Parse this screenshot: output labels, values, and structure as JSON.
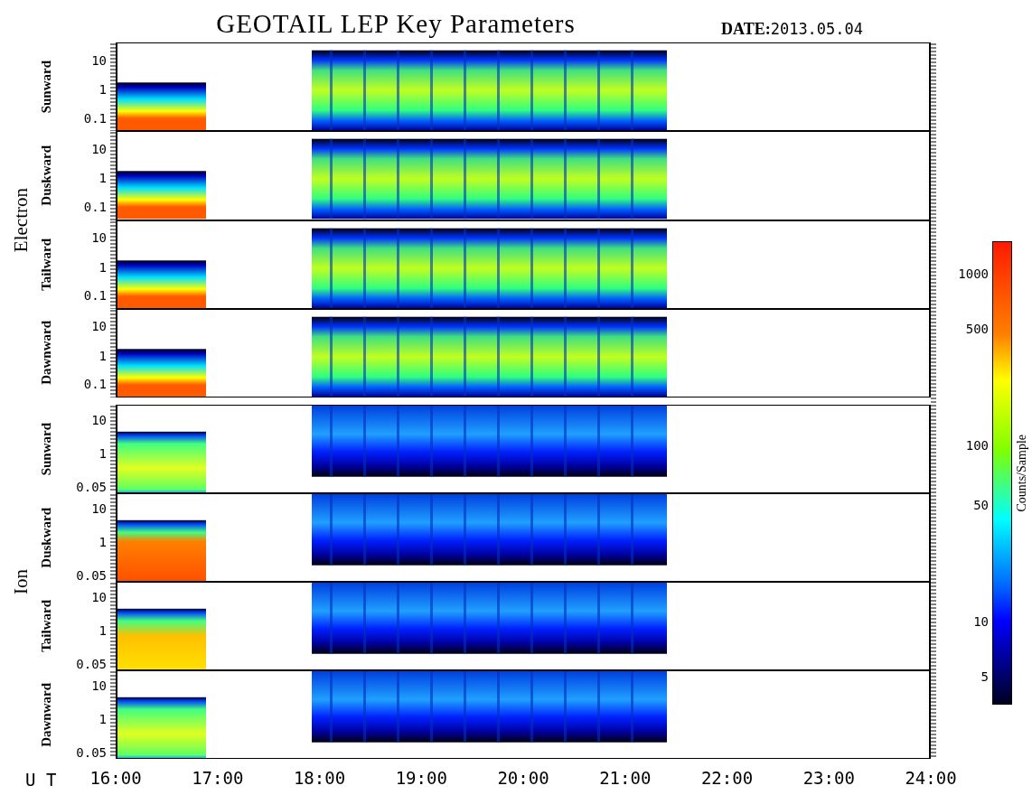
{
  "title": "GEOTAIL LEP Key Parameters",
  "date": {
    "label": "DATE:",
    "value": "2013.05.04"
  },
  "groups": [
    {
      "name": "Electron",
      "kind": "electron",
      "panels": [
        {
          "direction": "Sunward",
          "yticks": [
            "10",
            "1",
            "0.1"
          ]
        },
        {
          "direction": "Duskward",
          "yticks": [
            "10",
            "1",
            "0.1"
          ]
        },
        {
          "direction": "Tailward",
          "yticks": [
            "10",
            "1",
            "0.1"
          ]
        },
        {
          "direction": "Dawnward",
          "yticks": [
            "10",
            "1",
            "0.1"
          ]
        }
      ]
    },
    {
      "name": "Ion",
      "kind": "ion",
      "panels": [
        {
          "direction": "Sunward",
          "yticks": [
            "10",
            "1",
            "0.05"
          ]
        },
        {
          "direction": "Duskward",
          "yticks": [
            "10",
            "1",
            "0.05"
          ]
        },
        {
          "direction": "Tailward",
          "yticks": [
            "10",
            "1",
            "0.05"
          ]
        },
        {
          "direction": "Dawnward",
          "yticks": [
            "10",
            "1",
            "0.05"
          ]
        }
      ]
    }
  ],
  "time_axis": {
    "label": "U T",
    "ticks": [
      "16:00",
      "17:00",
      "18:00",
      "19:00",
      "20:00",
      "21:00",
      "22:00",
      "23:00",
      "24:00"
    ]
  },
  "colorbar": {
    "label": "Counts/Sample",
    "ticks": [
      "1000",
      "500",
      "100",
      "50",
      "10",
      "5"
    ]
  }
}
